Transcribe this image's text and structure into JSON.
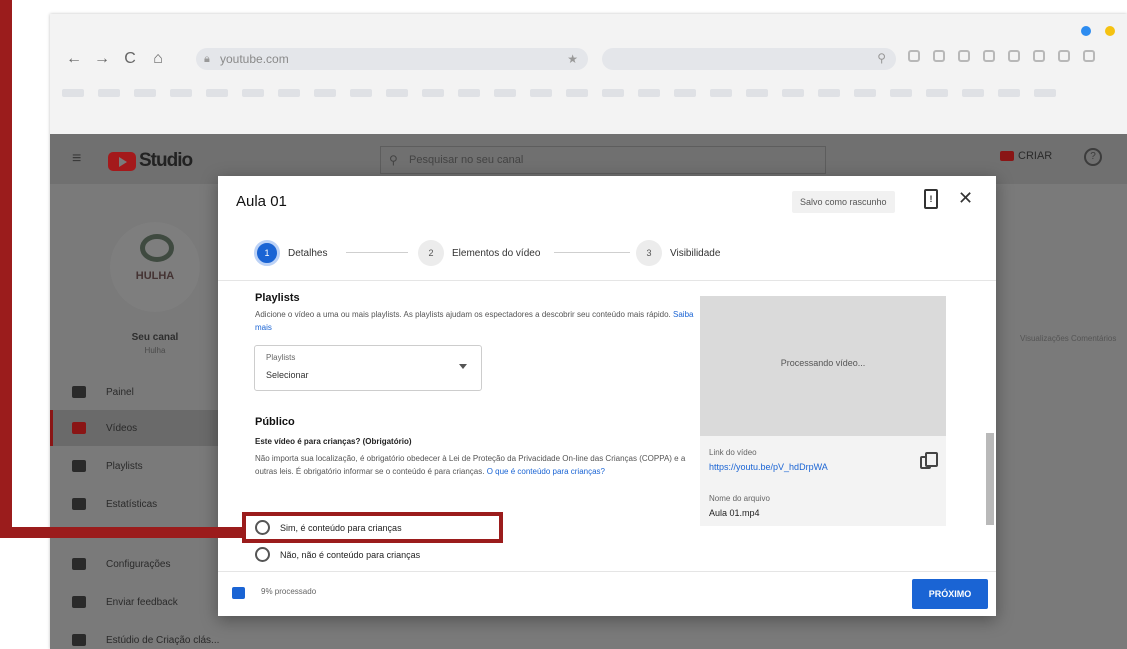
{
  "colors": {
    "annotation_red": "#9b1c1c",
    "accent_blue": "#1a64d4",
    "yt_red": "#a4191b",
    "window_dot_blue": "#2d8cf0",
    "window_dot_yellow": "#f5c211"
  },
  "browser": {
    "url": "youtube.com",
    "nav_icons": [
      "arrow-left-icon",
      "arrow-right-icon",
      "reload-icon",
      "home-icon"
    ]
  },
  "studio": {
    "logo_text": "Studio",
    "search_placeholder": "Pesquisar no seu canal",
    "create_label": "CRIAR",
    "help_glyph": "?",
    "channel": {
      "brand": "HULHA",
      "name": "Seu canal",
      "subtitle": "Hulha"
    },
    "sidebar": [
      {
        "label": "Painel",
        "icon": "dashboard-icon"
      },
      {
        "label": "Vídeos",
        "icon": "videos-icon"
      },
      {
        "label": "Playlists",
        "icon": "playlists-icon"
      },
      {
        "label": "Estatísticas",
        "icon": "analytics-icon"
      },
      {
        "label": "Configurações",
        "icon": "settings-icon"
      },
      {
        "label": "Enviar feedback",
        "icon": "feedback-icon"
      },
      {
        "label": "Estúdio de Criação clás...",
        "icon": "classic-studio-icon"
      }
    ],
    "background_columns": "Visualizações   Comentários"
  },
  "dialog": {
    "title": "Aula 01",
    "saved_label": "Salvo como rascunho",
    "alert_glyph": "!",
    "close_glyph": "✕",
    "steps": [
      {
        "num": "1",
        "label": "Detalhes"
      },
      {
        "num": "2",
        "label": "Elementos do vídeo"
      },
      {
        "num": "3",
        "label": "Visibilidade"
      }
    ],
    "playlist": {
      "heading": "Playlists",
      "description": "Adicione o vídeo a uma ou mais playlists. As playlists ajudam os espectadores a descobrir seu conteúdo mais rápido.",
      "learn_more": "Saiba mais",
      "select_label": "Playlists",
      "select_value": "Selecionar"
    },
    "audience": {
      "heading": "Público",
      "question": "Este vídeo é para crianças? (Obrigatório)",
      "description": "Não importa sua localização, é obrigatório obedecer à Lei de Proteção da Privacidade On-line das Crianças (COPPA) e a outras leis. É obrigatório informar se o conteúdo é para crianças.",
      "learn_link": "O que é conteúdo para crianças?",
      "option_yes": "Sim, é conteúdo para crianças",
      "option_no": "Não, não é conteúdo para crianças"
    },
    "preview": {
      "processing": "Processando vídeo...",
      "link_label": "Link do vídeo",
      "link": "https://youtu.be/pV_hdDrpWA",
      "file_label": "Nome do arquivo",
      "file": "Aula 01.mp4"
    },
    "footer": {
      "status": "9% processado",
      "next_label": "PRÓXIMO"
    }
  }
}
